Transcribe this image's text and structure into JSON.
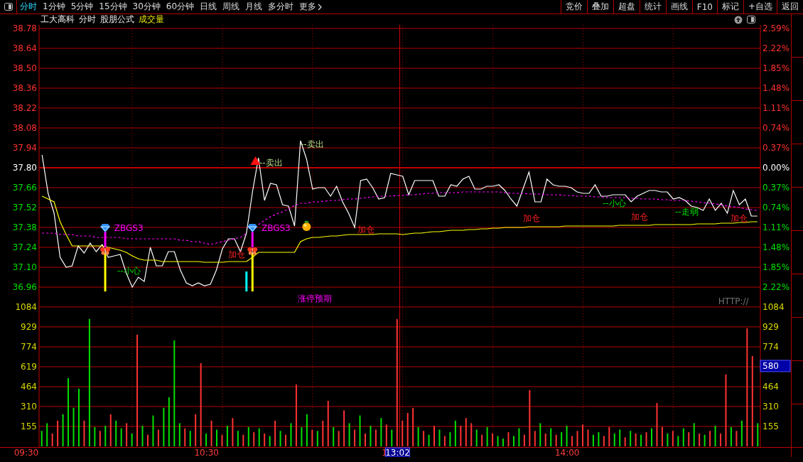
{
  "toolbar": {
    "tabs": [
      {
        "label": "分时",
        "selected": true,
        "kind": "period"
      },
      {
        "label": "1分钟",
        "selected": false,
        "kind": "period"
      },
      {
        "label": "5分钟",
        "selected": false,
        "kind": "period"
      },
      {
        "label": "15分钟",
        "selected": false,
        "kind": "period"
      },
      {
        "label": "30分钟",
        "selected": false,
        "kind": "period"
      },
      {
        "label": "60分钟",
        "selected": false,
        "kind": "period"
      },
      {
        "label": "日线",
        "selected": false,
        "kind": "period"
      },
      {
        "label": "周线",
        "selected": false,
        "kind": "period"
      },
      {
        "label": "月线",
        "selected": false,
        "kind": "period"
      },
      {
        "label": "多分时",
        "selected": false,
        "kind": "period"
      },
      {
        "label": "更多",
        "selected": false,
        "kind": "menu"
      }
    ],
    "buttons": [
      "竞价",
      "叠加",
      "超盘",
      "统计",
      "画线",
      "F10",
      "标记",
      "+自选",
      "返回"
    ]
  },
  "title_bar": {
    "items": [
      {
        "text": "工大高科",
        "kind": "label"
      },
      {
        "text": "分时",
        "kind": "label"
      },
      {
        "text": "股朋公式",
        "kind": "label"
      },
      {
        "text": "成交量",
        "kind": "indicator"
      }
    ]
  },
  "price_panel": {
    "chart_data": {
      "type": "line",
      "grid": true,
      "ylim": [
        36.96,
        38.78
      ],
      "yticks": [
        {
          "value": 38.78,
          "label": "38.78"
        },
        {
          "value": 38.64,
          "label": "38.64"
        },
        {
          "value": 38.5,
          "label": "38.50"
        },
        {
          "value": 38.36,
          "label": "38.36"
        },
        {
          "value": 38.22,
          "label": "38.22"
        },
        {
          "value": 38.08,
          "label": "38.08"
        },
        {
          "value": 37.94,
          "label": "37.94"
        },
        {
          "value": 37.8,
          "label": "37.80"
        },
        {
          "value": 37.66,
          "label": "37.66"
        },
        {
          "value": 37.52,
          "label": "37.52"
        },
        {
          "value": 37.38,
          "label": "37.38"
        },
        {
          "value": 37.24,
          "label": "37.24"
        },
        {
          "value": 37.1,
          "label": "37.10"
        },
        {
          "value": 36.96,
          "label": "36.96"
        }
      ],
      "categories": [
        null,
        null,
        null,
        null,
        null,
        null,
        null,
        null,
        null,
        null,
        null,
        null,
        null,
        null,
        null,
        null,
        null,
        null,
        null,
        null,
        null,
        null,
        null,
        null,
        null,
        null,
        null,
        null,
        null,
        null,
        null,
        null,
        null,
        null,
        null,
        null,
        null,
        null,
        null,
        null,
        null,
        null,
        null,
        null,
        null,
        null,
        null,
        null,
        null,
        null,
        null,
        null,
        null,
        null,
        null,
        null,
        null,
        null,
        null,
        null,
        null,
        null,
        null,
        null,
        null,
        null,
        null,
        null,
        null,
        null,
        null,
        null,
        null,
        null,
        null,
        null,
        null,
        null,
        null,
        null,
        null,
        null,
        null,
        null,
        null,
        null,
        null,
        null,
        null,
        null,
        null,
        null,
        null,
        null,
        null,
        null,
        null,
        null,
        null,
        null,
        null,
        null,
        null,
        null,
        null,
        null,
        null,
        null,
        null,
        null,
        null,
        null,
        null,
        null,
        null,
        null,
        null,
        null,
        null,
        null
      ],
      "series": [
        {
          "color": "#ffffff",
          "line_style": "solid",
          "values": [
            37.89,
            37.62,
            37.48,
            37.17,
            37.1,
            37.11,
            37.25,
            37.2,
            37.27,
            37.21,
            37.26,
            37.17,
            37.18,
            37.19,
            37.06,
            36.96,
            37.03,
            37.0,
            37.24,
            37.11,
            37.11,
            37.21,
            37.21,
            37.08,
            36.99,
            36.97,
            36.99,
            36.97,
            36.98,
            37.08,
            37.23,
            37.3,
            37.3,
            37.21,
            37.34,
            37.63,
            37.87,
            37.57,
            37.69,
            37.68,
            37.54,
            37.53,
            37.39,
            37.99,
            37.86,
            37.65,
            37.66,
            37.66,
            37.6,
            37.67,
            37.56,
            37.48,
            37.38,
            37.71,
            37.72,
            37.66,
            37.58,
            37.59,
            37.76,
            37.75,
            37.74,
            37.61,
            37.71,
            37.71,
            37.71,
            37.71,
            37.6,
            37.6,
            37.68,
            37.67,
            37.72,
            37.74,
            37.65,
            37.65,
            37.67,
            37.67,
            37.68,
            37.64,
            37.58,
            37.53,
            37.65,
            37.77,
            37.56,
            37.56,
            37.72,
            37.68,
            37.67,
            37.67,
            37.66,
            37.63,
            37.62,
            37.62,
            37.68,
            37.6,
            37.6,
            37.61,
            37.61,
            37.61,
            37.56,
            37.6,
            37.62,
            37.64,
            37.64,
            37.63,
            37.63,
            37.58,
            37.59,
            37.57,
            37.53,
            37.52,
            37.5,
            37.58,
            37.5,
            37.55,
            37.48,
            37.64,
            37.54,
            37.58,
            37.46,
            37.46
          ]
        },
        {
          "color": "#ff00ff",
          "line_style": "dashed",
          "values": [
            37.34,
            37.34,
            37.34,
            37.33,
            37.33,
            37.33,
            37.32,
            37.32,
            37.32,
            37.31,
            37.31,
            37.31,
            37.31,
            37.31,
            37.3,
            37.3,
            37.3,
            37.3,
            37.3,
            37.3,
            37.3,
            37.3,
            37.3,
            37.29,
            37.29,
            37.28,
            37.28,
            37.27,
            37.26,
            37.27,
            37.28,
            37.29,
            37.3,
            37.31,
            37.34,
            null,
            37.4,
            37.43,
            37.455,
            37.475,
            37.49,
            37.51,
            37.535,
            37.55,
            37.55,
            37.56,
            37.56,
            37.565,
            37.57,
            37.57,
            37.575,
            37.58,
            37.58,
            37.585,
            37.59,
            37.595,
            37.6,
            37.6,
            37.6,
            37.605,
            37.605,
            37.61,
            37.61,
            37.615,
            37.62,
            37.62,
            37.625,
            37.625,
            37.625,
            37.625,
            37.63,
            37.63,
            37.63,
            37.63,
            37.63,
            37.63,
            37.63,
            37.625,
            37.62,
            37.62,
            37.62,
            37.615,
            37.615,
            37.615,
            37.61,
            37.61,
            37.61,
            37.605,
            37.605,
            37.6,
            37.6,
            37.6,
            37.595,
            37.595,
            37.59,
            37.59,
            37.59,
            37.59,
            37.585,
            37.585,
            37.58,
            37.58,
            37.58,
            37.575,
            37.575,
            37.57,
            37.57,
            37.57,
            37.565,
            37.56,
            37.555,
            37.55,
            37.545,
            37.54,
            37.53,
            37.525,
            37.52,
            37.51,
            37.505,
            37.5
          ]
        },
        {
          "color": "#ffff00",
          "line_style": "solid",
          "values": [
            37.6,
            37.58,
            37.56,
            37.42,
            37.33,
            37.25,
            37.25,
            37.25,
            37.25,
            37.25,
            37.25,
            37.24,
            37.23,
            37.22,
            37.205,
            37.18,
            37.16,
            37.15,
            37.15,
            37.15,
            37.14,
            37.14,
            37.14,
            37.14,
            37.14,
            37.14,
            37.14,
            37.135,
            37.135,
            37.135,
            37.135,
            37.14,
            37.14,
            37.14,
            37.14,
            37.17,
            37.205,
            37.205,
            37.205,
            37.205,
            37.205,
            37.205,
            37.205,
            37.28,
            37.3,
            37.31,
            37.31,
            37.315,
            37.32,
            37.32,
            37.325,
            37.33,
            37.33,
            37.33,
            37.33,
            37.33,
            37.335,
            37.335,
            37.335,
            37.335,
            37.33,
            37.335,
            37.34,
            37.34,
            37.345,
            37.35,
            37.35,
            37.355,
            37.36,
            37.36,
            37.36,
            37.365,
            37.365,
            37.37,
            37.37,
            37.375,
            37.375,
            37.38,
            37.38,
            37.38,
            37.38,
            37.385,
            37.385,
            37.385,
            37.385,
            37.385,
            37.385,
            37.39,
            37.39,
            37.39,
            37.39,
            37.39,
            37.39,
            37.39,
            37.39,
            37.39,
            37.395,
            37.395,
            37.395,
            37.395,
            37.395,
            37.395,
            37.4,
            37.4,
            37.4,
            37.4,
            37.4,
            37.4,
            37.4,
            37.405,
            37.405,
            37.405,
            37.405,
            37.41,
            37.41,
            37.41,
            37.415,
            37.415,
            37.42,
            37.42
          ]
        }
      ]
    },
    "signals": [
      {
        "text": "ZBGS3",
        "kind": "code"
      },
      {
        "text": "ZBGS3",
        "kind": "code"
      },
      {
        "text": "--卖出",
        "kind": "sell"
      },
      {
        "text": "--卖出",
        "kind": "sell"
      },
      {
        "text": "--小心",
        "kind": "caution"
      },
      {
        "text": "--小心",
        "kind": "caution"
      },
      {
        "text": "加仓",
        "kind": "add"
      },
      {
        "text": "加仓",
        "kind": "add"
      },
      {
        "text": "加仓",
        "kind": "add"
      },
      {
        "text": "加仓",
        "kind": "add"
      },
      {
        "text": "加仓",
        "kind": "add"
      },
      {
        "text": "--走弱",
        "kind": "weak"
      },
      {
        "text": "涨停预期",
        "kind": "forecast"
      },
      {
        "text": "HTTP://",
        "kind": "link"
      }
    ],
    "percent_ticks": [
      {
        "label": "2.59%",
        "color": "#ff3030"
      },
      {
        "label": "2.22%",
        "color": "#ff3030"
      },
      {
        "label": "1.85%",
        "color": "#ff3030"
      },
      {
        "label": "1.48%",
        "color": "#ff3030"
      },
      {
        "label": "1.11%",
        "color": "#ff3030"
      },
      {
        "label": "0.74%",
        "color": "#ff3030"
      },
      {
        "label": "0.37%",
        "color": "#ff3030"
      },
      {
        "label": "0.00%",
        "color": "#ffffff"
      },
      {
        "label": "0.37%",
        "color": "#00e000"
      },
      {
        "label": "0.74%",
        "color": "#00e000"
      },
      {
        "label": "1.11%",
        "color": "#00e000"
      },
      {
        "label": "1.48%",
        "color": "#00e000"
      },
      {
        "label": "1.85%",
        "color": "#00e000"
      },
      {
        "label": "2.22%",
        "color": "#00e000"
      }
    ]
  },
  "volume_panel": {
    "right_ticks": [
      "1084",
      "929",
      "774",
      "464",
      "310",
      "155"
    ],
    "time_axis": [
      "09:30",
      "10:30",
      "1",
      "14:00"
    ],
    "crosshair": {
      "time": "13:02",
      "volume": "580"
    },
    "bars": [
      {
        "color": "#00e000"
      },
      {
        "color": "#00e000"
      },
      {
        "color": "#ff3232"
      },
      {
        "color": "#ff3232"
      },
      {
        "color": "#00e000"
      },
      {
        "color": "#00e000"
      },
      {
        "color": "#00e000"
      },
      {
        "color": "#00e000"
      },
      {
        "color": "#ff3232"
      },
      {
        "color": "#00e000"
      },
      {
        "color": "#00e000"
      },
      {
        "color": "#ff3232"
      },
      {
        "color": "#00e000"
      },
      {
        "color": "#ff3232"
      },
      {
        "color": "#00e000"
      },
      {
        "color": "#00e000"
      },
      {
        "color": "#ff3232"
      },
      {
        "color": "#00e000"
      },
      {
        "color": "#ff3232"
      },
      {
        "color": "#00e000"
      },
      {
        "color": "#ff3232"
      },
      {
        "color": "#00e000"
      },
      {
        "color": "#ff3232"
      },
      {
        "color": "#00e000"
      },
      {
        "color": "#00e000"
      },
      {
        "color": "#00e000"
      },
      {
        "color": "#00e000"
      },
      {
        "color": "#ff3232"
      },
      {
        "color": "#00e000"
      },
      {
        "color": "#ff3232"
      },
      {
        "color": "#ff3232"
      },
      {
        "color": "#00e000"
      },
      {
        "color": "#ff3232"
      },
      {
        "color": "#00e000"
      },
      {
        "color": "#ff3232"
      },
      {
        "color": "#00e000"
      },
      {
        "color": "#ff3232"
      },
      {
        "color": "#00e000"
      },
      {
        "color": "#ff3232"
      },
      {
        "color": "#00e000"
      },
      {
        "color": "#ff3232"
      },
      {
        "color": "#00e000"
      },
      {
        "color": "#ff3232"
      },
      {
        "color": "#00e000"
      },
      {
        "color": "#ff3232"
      },
      {
        "color": "#00e000"
      },
      {
        "color": "#ff3232"
      },
      {
        "color": "#00e000"
      },
      {
        "color": "#ff3232"
      },
      {
        "color": "#00e000"
      },
      {
        "color": "#00e000"
      },
      {
        "color": "#ff3232"
      },
      {
        "color": "#00e000"
      },
      {
        "color": "#ff3232"
      },
      {
        "color": "#ff3232"
      },
      {
        "color": "#00e000"
      },
      {
        "color": "#ff3232"
      },
      {
        "color": "#ff3232"
      },
      {
        "color": "#00e000"
      },
      {
        "color": "#ff3232"
      },
      {
        "color": "#00e000"
      },
      {
        "color": "#ff3232"
      },
      {
        "color": "#00e000"
      },
      {
        "color": "#ff3232"
      },
      {
        "color": "#00e000"
      },
      {
        "color": "#ff3232"
      },
      {
        "color": "#00e000"
      },
      {
        "color": "#ff3232"
      },
      {
        "color": "#ff3232"
      },
      {
        "color": "#ff3232"
      },
      {
        "color": "#ff3232"
      },
      {
        "color": "#00e000"
      },
      {
        "color": "#ff3232"
      },
      {
        "color": "#00e000"
      },
      {
        "color": "#ff3232"
      },
      {
        "color": "#00e000"
      },
      {
        "color": "#ff3232"
      },
      {
        "color": "#00e000"
      },
      {
        "color": "#00e000"
      },
      {
        "color": "#ff3232"
      },
      {
        "color": "#ff3232"
      },
      {
        "color": "#ff3232"
      },
      {
        "color": "#00e000"
      },
      {
        "color": "#ff3232"
      },
      {
        "color": "#00e000"
      },
      {
        "color": "#ff3232"
      },
      {
        "color": "#00e000"
      },
      {
        "color": "#00e000"
      },
      {
        "color": "#ff3232"
      },
      {
        "color": "#00e000"
      },
      {
        "color": "#00e000"
      },
      {
        "color": "#ff3232"
      },
      {
        "color": "#ff3232"
      },
      {
        "color": "#ff3232"
      },
      {
        "color": "#00e000"
      },
      {
        "color": "#ff3232"
      },
      {
        "color": "#00e000"
      },
      {
        "color": "#ff3232"
      },
      {
        "color": "#00e000"
      },
      {
        "color": "#00e000"
      },
      {
        "color": "#ff3232"
      },
      {
        "color": "#ff3232"
      },
      {
        "color": "#ff3232"
      },
      {
        "color": "#ff3232"
      },
      {
        "color": "#00e000"
      },
      {
        "color": "#00e000"
      },
      {
        "color": "#ff3232"
      },
      {
        "color": "#ff3232"
      },
      {
        "color": "#00e000"
      },
      {
        "color": "#00e000"
      },
      {
        "color": "#ff3232"
      },
      {
        "color": "#00e000"
      },
      {
        "color": "#ff3232"
      },
      {
        "color": "#00e000"
      },
      {
        "color": "#ff3232"
      },
      {
        "color": "#00e000"
      },
      {
        "color": "#ff3232"
      },
      {
        "color": "#ff3232"
      },
      {
        "color": "#00e000"
      },
      {
        "color": "#ff3232"
      },
      {
        "color": "#00e000"
      },
      {
        "color": "#00e000"
      },
      {
        "color": "#ff3232"
      },
      {
        "color": "#00e000"
      },
      {
        "color": "#ff3232"
      },
      {
        "color": "#00e000"
      },
      {
        "color": "#ff3232"
      },
      {
        "color": "#00e000"
      },
      {
        "color": "#ff3232"
      },
      {
        "color": "#ff3232"
      },
      {
        "color": "#00e000"
      },
      {
        "color": "#ff3232"
      },
      {
        "color": "#00e000"
      },
      {
        "color": "#ff3232"
      },
      {
        "color": "#ff3232"
      },
      {
        "color": "#00e000"
      }
    ],
    "chart_data": {
      "type": "bar",
      "grid": true,
      "ylim": [
        0,
        1122
      ],
      "yticks": [
        {
          "value": 1084,
          "label": "1084"
        },
        {
          "value": 929,
          "label": "929"
        },
        {
          "value": 774,
          "label": "774"
        },
        {
          "value": 619,
          "label": "619"
        },
        {
          "value": 464,
          "label": "464"
        },
        {
          "value": 310,
          "label": "310"
        },
        {
          "value": 155,
          "label": "155"
        }
      ],
      "categories": [
        null,
        null,
        null,
        null,
        null,
        null,
        null,
        null,
        null,
        null,
        null,
        null,
        null,
        null,
        null,
        null,
        null,
        null,
        null,
        null,
        null,
        null,
        null,
        null,
        null,
        null,
        null,
        null,
        null,
        null,
        null,
        null,
        null,
        null,
        null,
        null,
        null,
        null,
        null,
        null,
        null,
        null,
        null,
        null,
        null,
        null,
        null,
        null,
        null,
        null,
        null,
        null,
        null,
        null,
        null,
        null,
        null,
        null,
        null,
        null,
        null,
        null,
        null,
        null,
        null,
        null,
        null,
        null,
        null,
        null,
        null,
        null,
        null,
        null,
        null,
        null,
        null,
        null,
        null,
        null,
        null,
        null,
        null,
        null,
        null,
        null,
        null,
        null,
        null,
        null,
        null,
        null,
        null,
        null,
        null,
        null,
        null,
        null,
        null,
        null,
        null,
        null,
        null,
        null,
        null,
        null,
        null,
        null,
        null,
        null,
        null,
        null,
        null,
        null,
        null,
        null,
        null,
        null,
        null,
        null,
        null,
        null,
        null,
        null,
        null,
        null,
        null,
        null,
        null,
        null,
        null,
        null,
        null,
        null,
        null,
        null
      ],
      "values": [
        120,
        180,
        100,
        200,
        250,
        531,
        300,
        448,
        200,
        990,
        150,
        120,
        160,
        250,
        200,
        140,
        180,
        100,
        868,
        160,
        90,
        240,
        130,
        300,
        382,
        824,
        180,
        140,
        120,
        250,
        647,
        100,
        200,
        130,
        90,
        160,
        220,
        120,
        90,
        150,
        110,
        140,
        100,
        80,
        200,
        120,
        90,
        180,
        481,
        150,
        250,
        130,
        120,
        200,
        354,
        150,
        120,
        280,
        180,
        130,
        240,
        100,
        160,
        130,
        220,
        170,
        130,
        990,
        200,
        260,
        299,
        150,
        120,
        90,
        160,
        130,
        80,
        110,
        200,
        160,
        220,
        180,
        130,
        90,
        150,
        100,
        80,
        60,
        110,
        80,
        140,
        90,
        437,
        120,
        180,
        100,
        140,
        90,
        110,
        160,
        80,
        120,
        170,
        130,
        90,
        110,
        80,
        150,
        100,
        130,
        70,
        120,
        100,
        90,
        110,
        140,
        337,
        150,
        100,
        120,
        80,
        140,
        110,
        180,
        100,
        90,
        120,
        160,
        100,
        559,
        150,
        120,
        200,
        918,
        702,
        180
      ]
    }
  }
}
